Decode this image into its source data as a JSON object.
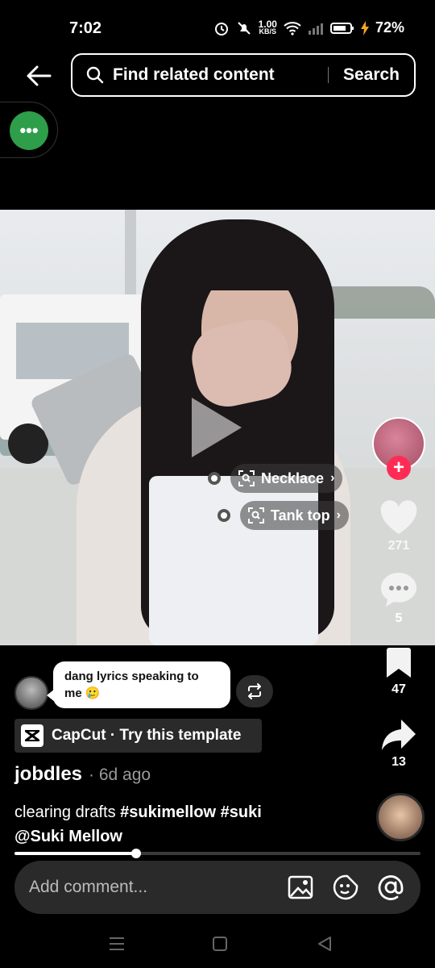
{
  "status_bar": {
    "time": "7:02",
    "net_speed_value": "1.00",
    "net_speed_unit": "KB/S",
    "battery": "72%"
  },
  "header": {
    "search_placeholder": "Find related content",
    "search_button": "Search"
  },
  "floating_bubble": {
    "label": "•••"
  },
  "video": {
    "tags": [
      {
        "label": "Necklace"
      },
      {
        "label": "Tank top"
      }
    ]
  },
  "rail": {
    "likes": "271",
    "comments": "5",
    "bookmarks": "47",
    "shares": "13"
  },
  "comment_preview": {
    "text": "dang lyrics speaking to me 🥲"
  },
  "capcut": {
    "label": "CapCut · Try this template"
  },
  "post": {
    "author": "jobdles",
    "meta": "· 6d ago",
    "caption_text": "clearing drafts ",
    "hashtags": [
      "#sukimellow",
      "#suki"
    ],
    "mention": "@Suki Mellow"
  },
  "playback": {
    "progress": 0.3
  },
  "comment_input": {
    "placeholder": "Add comment..."
  },
  "colors": {
    "accent_follow": "#fe2c55",
    "bubble_green": "#2e9e4a"
  }
}
